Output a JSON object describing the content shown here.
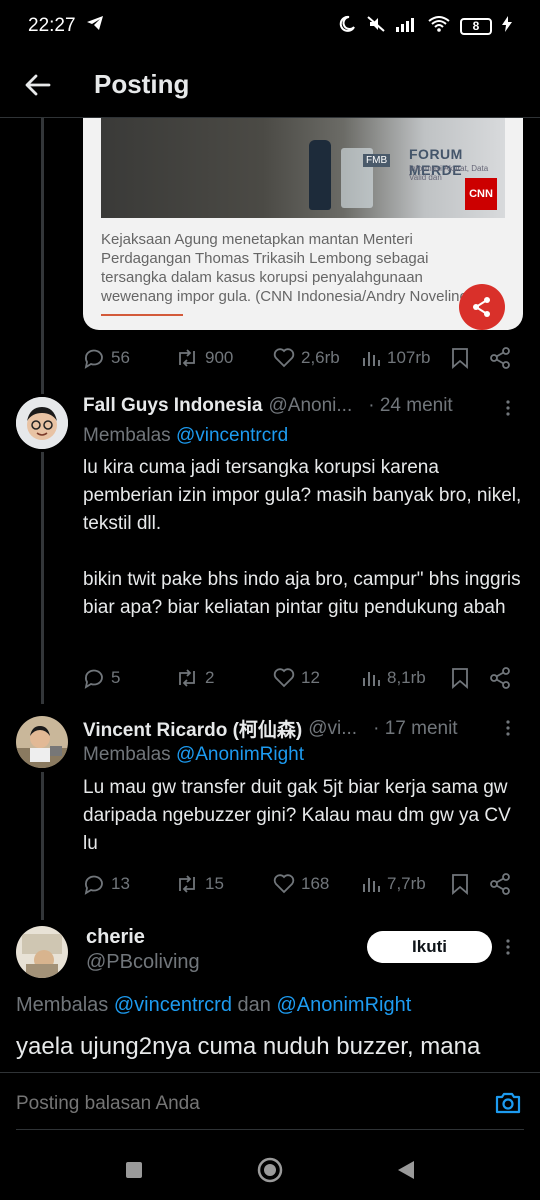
{
  "status_bar": {
    "time": "22:27",
    "battery": "8"
  },
  "header": {
    "title": "Posting"
  },
  "media": {
    "forum_text": "FORUM MERDE",
    "forum_sub": "Informasi Akurat, Data Valid dan",
    "fmb_label": "FMB",
    "cnn_label": "CNN",
    "caption": "Kejaksaan Agung menetapkan mantan Menteri Perdagangan Thomas Trikasih Lembong sebagai tersangka dalam kasus korupsi penyalahgunaan wewenang impor gula. (CNN Indonesia/Andry Novelino)"
  },
  "main_actions": {
    "replies": "56",
    "reposts": "900",
    "likes": "2,6rb",
    "views": "107rb"
  },
  "tweets": [
    {
      "name": "Fall Guys Indonesia",
      "handle": "@Anoni...",
      "time": "· 24 menit",
      "reply_prefix": "Membalas",
      "reply_to": "@vincentrcrd",
      "text": "lu kira cuma jadi tersangka korupsi karena pemberian izin impor gula? masih banyak bro, nikel, tekstil dll.\n\nbikin twit pake bhs indo aja bro, campur\" bhs inggris biar apa? biar keliatan pintar gitu pendukung abah",
      "replies": "5",
      "reposts": "2",
      "likes": "12",
      "views": "8,1rb"
    },
    {
      "name": "Vincent Ricardo (柯仙森)",
      "handle": "@vi...",
      "time": "· 17 menit",
      "reply_prefix": "Membalas",
      "reply_to": "@AnonimRight",
      "text": "Lu mau gw transfer duit gak 5jt biar kerja sama gw daripada ngebuzzer gini? Kalau mau dm gw ya CV lu",
      "replies": "13",
      "reposts": "15",
      "likes": "168",
      "views": "7,7rb"
    }
  ],
  "focus_tweet": {
    "name": "cherie",
    "handle": "@PBcoliving",
    "follow_label": "Ikuti",
    "reply_prefix": "Membalas",
    "reply_to_1": "@vincentrcrd",
    "reply_conj": "dan",
    "reply_to_2": "@AnonimRight",
    "text": "yaela ujung2nya cuma nuduh buzzer, mana"
  },
  "reply_bar": {
    "placeholder": "Posting balasan Anda"
  },
  "colors": {
    "accent": "#1d9bf0",
    "background": "#000000",
    "muted": "#71767b",
    "share_fab": "#d9302a"
  }
}
